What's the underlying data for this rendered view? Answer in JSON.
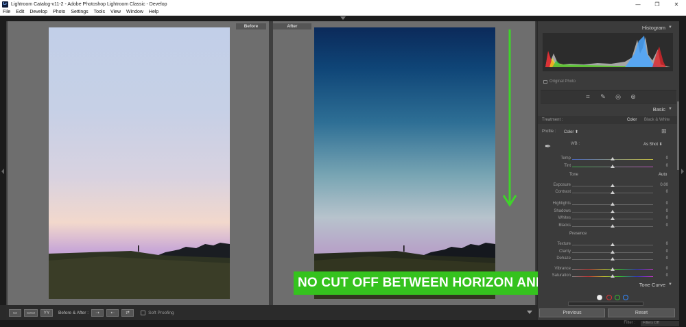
{
  "window": {
    "title": "Lightroom Catalog-v11-2 - Adobe Photoshop Lightroom Classic - Develop",
    "app_icon_text": "Lr",
    "controls": {
      "minimize": "—",
      "maximize": "❐",
      "close": "✕"
    }
  },
  "menu": [
    "File",
    "Edit",
    "Develop",
    "Photo",
    "Settings",
    "Tools",
    "View",
    "Window",
    "Help"
  ],
  "compare": {
    "before_label": "Before",
    "after_label": "After"
  },
  "caption": "NO CUT OFF BETWEEN HORIZON AND THE SKY",
  "toolbar": {
    "view_yy": "YY",
    "before_after_label": "Before & After :",
    "soft_proofing": "Soft Proofing"
  },
  "filmstrip": {
    "filter_label": "Filter :",
    "filter_value": "Filters Off"
  },
  "panels": {
    "histogram_title": "Histogram",
    "original_photo": "Original Photo",
    "basic_title": "Basic",
    "treatment_label": "Treatment :",
    "treatment_color": "Color",
    "treatment_bw": "Black & White",
    "profile_label": "Profile :",
    "profile_value": "Color ⬍",
    "wb_label": "WB :",
    "wb_value": "As Shot ⬍",
    "tone_label": "Tone",
    "auto_label": "Auto",
    "presence_label": "Presence",
    "tone_curve_title": "Tone Curve",
    "previous_button": "Previous",
    "reset_button": "Reset"
  },
  "sliders": [
    {
      "label": "Temp",
      "value": "0",
      "pos": 0.5
    },
    {
      "label": "Tint",
      "value": "0",
      "pos": 0.5
    },
    {
      "label": "Exposure",
      "value": "0.00",
      "pos": 0.5
    },
    {
      "label": "Contrast",
      "value": "0",
      "pos": 0.5
    },
    {
      "label": "Highlights",
      "value": "0",
      "pos": 0.5
    },
    {
      "label": "Shadows",
      "value": "0",
      "pos": 0.5
    },
    {
      "label": "Whites",
      "value": "0",
      "pos": 0.5
    },
    {
      "label": "Blacks",
      "value": "0",
      "pos": 0.5
    },
    {
      "label": "Texture",
      "value": "0",
      "pos": 0.5
    },
    {
      "label": "Clarity",
      "value": "0",
      "pos": 0.5
    },
    {
      "label": "Dehaze",
      "value": "0",
      "pos": 0.5
    },
    {
      "label": "Vibrance",
      "value": "0",
      "pos": 0.5
    },
    {
      "label": "Saturation",
      "value": "0",
      "pos": 0.5
    }
  ],
  "colors": {
    "caption_bg": "#35c21e",
    "arrow": "#3fd42a",
    "panel_bg": "#3b3b3b"
  }
}
